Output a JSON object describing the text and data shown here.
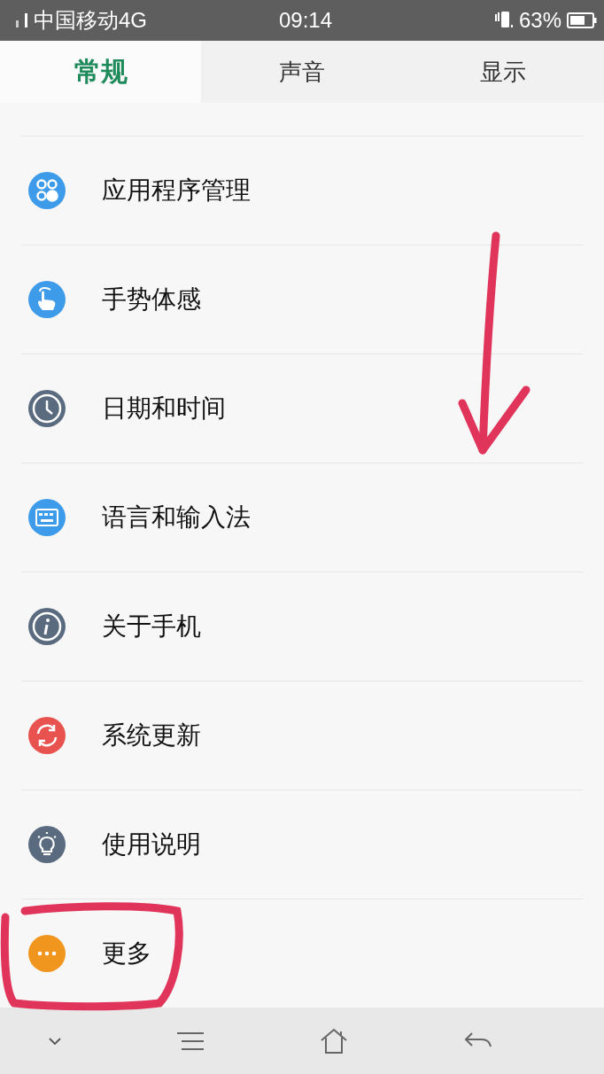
{
  "status_bar": {
    "carrier": "中国移动4G",
    "time": "09:14",
    "battery": "63%"
  },
  "tabs": [
    {
      "label": "常规",
      "selected": true
    },
    {
      "label": "声音",
      "selected": false
    },
    {
      "label": "显示",
      "selected": false
    }
  ],
  "items": [
    {
      "label": "应用程序管理",
      "kind": "apps",
      "color": "#3d9be9"
    },
    {
      "label": "手势体感",
      "kind": "gesture",
      "color": "#3d9be9"
    },
    {
      "label": "日期和时间",
      "kind": "clock",
      "color": "#5a6b80"
    },
    {
      "label": "语言和输入法",
      "kind": "keyboard",
      "color": "#3d9be9"
    },
    {
      "label": "关于手机",
      "kind": "info",
      "color": "#5a6b80"
    },
    {
      "label": "系统更新",
      "kind": "update",
      "color": "#e9534f"
    },
    {
      "label": "使用说明",
      "kind": "bulb",
      "color": "#5a6b80"
    },
    {
      "label": "更多",
      "kind": "more",
      "color": "#f0961e"
    }
  ]
}
